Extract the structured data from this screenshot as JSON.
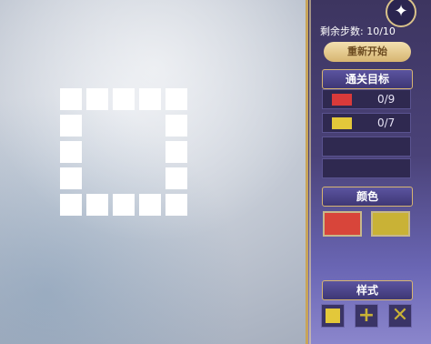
{
  "panel": {
    "steps_label": "剩余步数: 10/10",
    "restart_label": "重新开始",
    "goals_title": "通关目标",
    "goals": [
      {
        "color": "#d93a3a",
        "text": "0/9"
      },
      {
        "color": "#e3c83a",
        "text": "0/7"
      },
      {
        "color": "",
        "text": ""
      },
      {
        "color": "",
        "text": ""
      }
    ],
    "colors_title": "颜色",
    "colors": [
      "#d8453a",
      "#c9b236"
    ],
    "styles_title": "样式",
    "styles": [
      "square",
      "plus",
      "cross"
    ],
    "star_icon": "sparkle-icon"
  },
  "board": {
    "cell_color": "#ffffff",
    "pattern": "hollow-square-5x5"
  }
}
